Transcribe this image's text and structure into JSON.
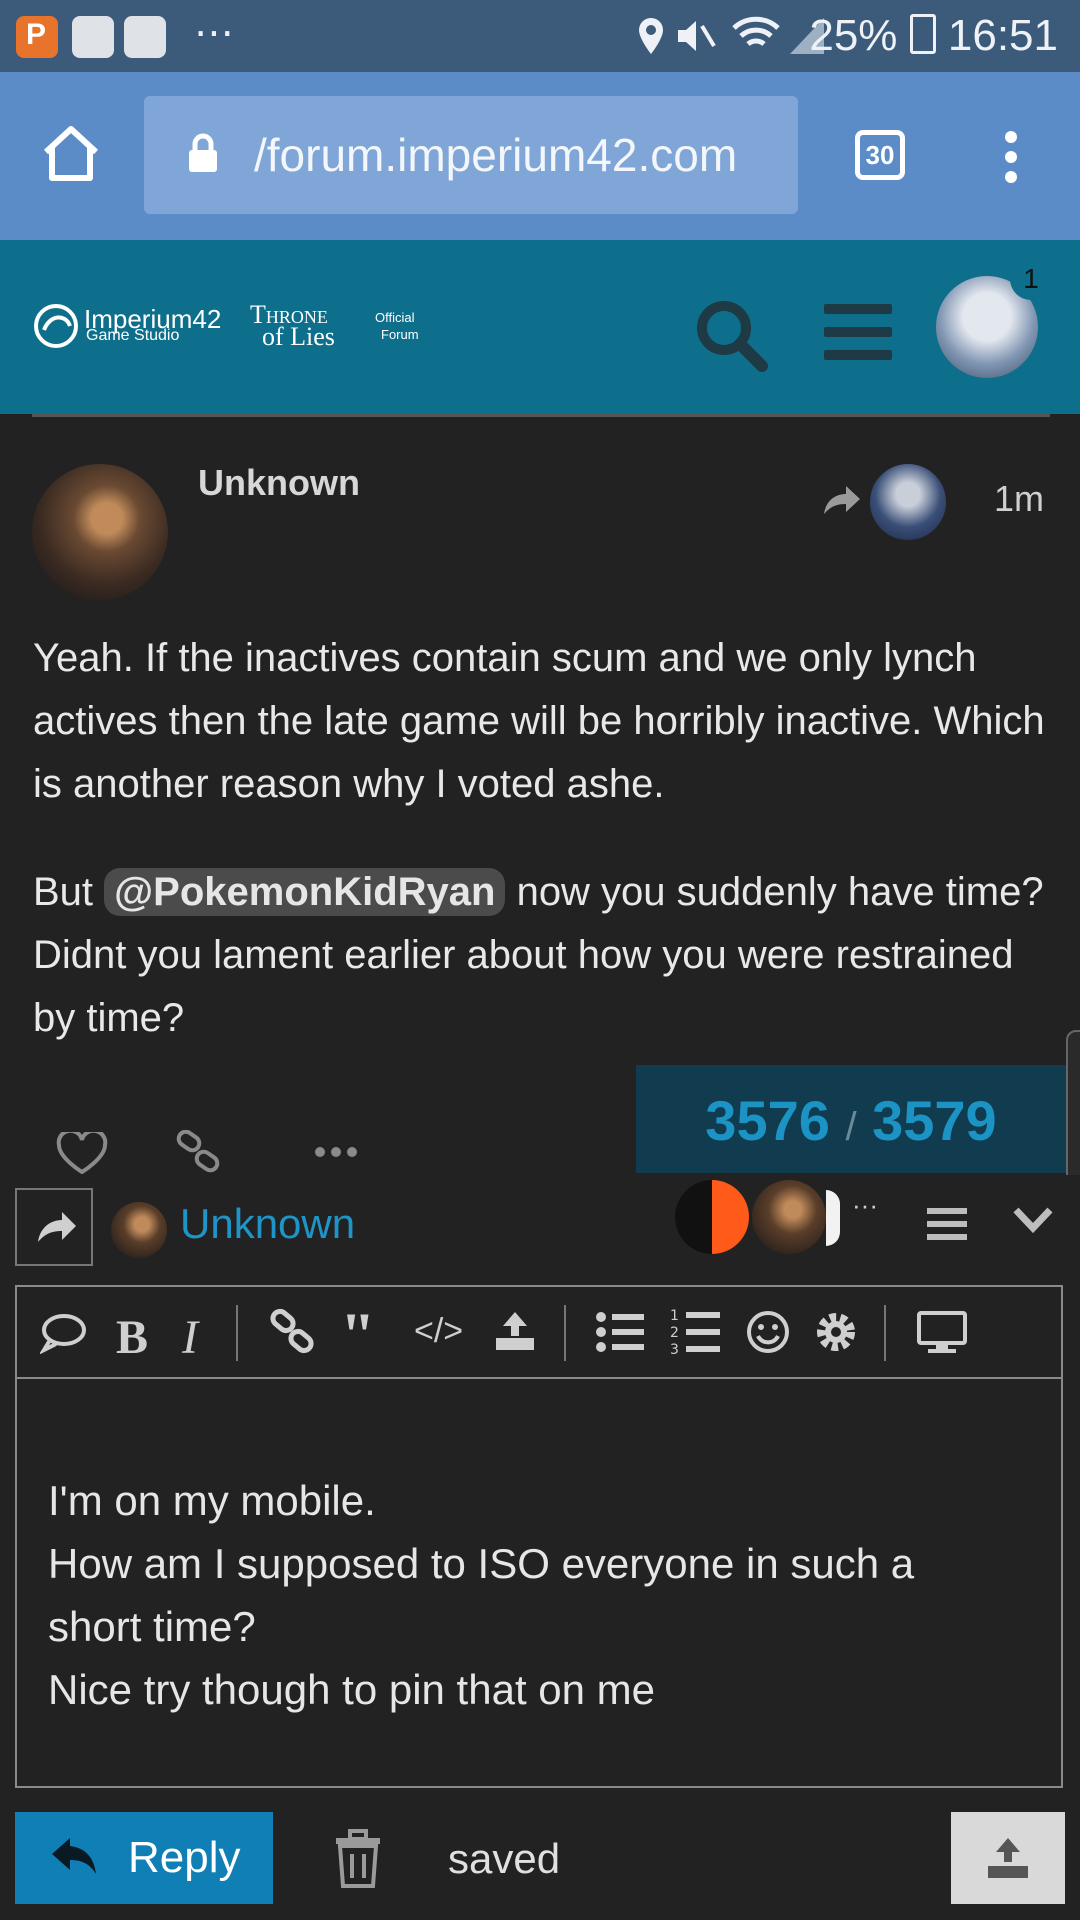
{
  "status_bar": {
    "battery": "25%",
    "time": "16:51",
    "overflow": "⋯"
  },
  "browser": {
    "url": "/forum.imperium42.com",
    "tab_count": "30"
  },
  "forum_header": {
    "studio_name": "Imperium42",
    "studio_sub": "Game Studio",
    "game_title_line1": "Throne",
    "game_title_line2": "of Lies",
    "forum_tag_line1": "Official",
    "forum_tag_line2": "Forum",
    "notification_count": "1"
  },
  "post": {
    "author": "Unknown",
    "age": "1m",
    "paragraph1": "Yeah. If the inactives contain scum and we only lynch actives then the late game will be horribly inactive. Which is another reason why I voted ashe.",
    "paragraph2_before": "But ",
    "mention": "@PokemonKidRyan",
    "paragraph2_after": " now you suddenly have time? Didnt you lament earlier about how you were restrained by time?"
  },
  "progress": {
    "current": "3576",
    "separator": "/",
    "total": "3579"
  },
  "composer": {
    "reply_to_user": "Unknown",
    "draft_lines": [
      "I'm on my mobile.",
      "How am I supposed to ISO everyone in such a",
      "short time?",
      "Nice try though to pin that on me"
    ],
    "reply_label": "Reply",
    "status": "saved",
    "more_indicator": "···"
  },
  "colors": {
    "accent": "#0f7fb5",
    "header": "#0e6f8c",
    "link": "#1e95c8"
  }
}
